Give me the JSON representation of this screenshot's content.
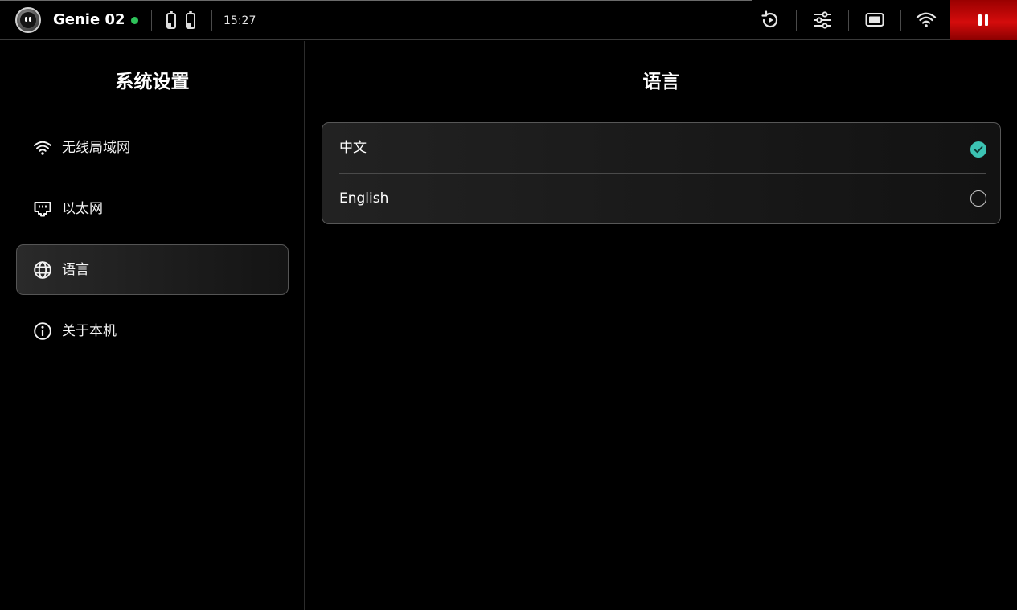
{
  "status_bar": {
    "device_name": "Genie 02",
    "connection_status_color": "#2ec35a",
    "batteries": [
      {
        "icon": "battery-icon",
        "level": 0.35
      },
      {
        "icon": "battery-icon",
        "level": 0.35
      }
    ],
    "time": "15:27",
    "icons": [
      "replay-icon",
      "sliders-icon",
      "screen-icon",
      "wifi-icon"
    ],
    "pause_icon": "pause-icon",
    "pause_color": "#d40c0c"
  },
  "sidebar": {
    "title": "系统设置",
    "items": [
      {
        "label": "无线局域网",
        "icon": "wifi-icon",
        "active": false
      },
      {
        "label": "以太网",
        "icon": "ethernet-icon",
        "active": false
      },
      {
        "label": "语言",
        "icon": "globe-icon",
        "active": true
      },
      {
        "label": "关于本机",
        "icon": "info-icon",
        "active": false
      }
    ]
  },
  "main": {
    "title": "语言",
    "options": [
      {
        "label": "中文",
        "selected": true
      },
      {
        "label": "English",
        "selected": false
      }
    ],
    "accent_color": "#3cc3b3"
  }
}
